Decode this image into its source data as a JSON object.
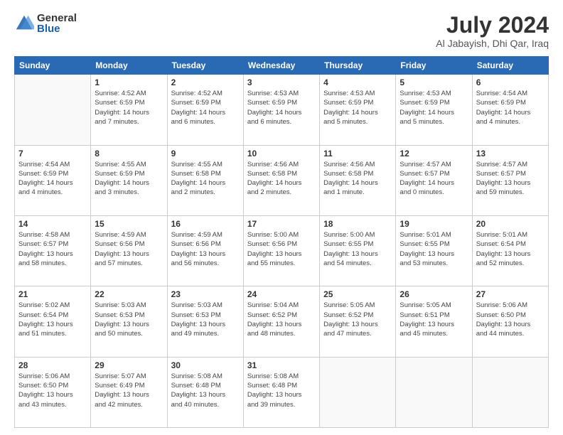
{
  "logo": {
    "general": "General",
    "blue": "Blue"
  },
  "title": "July 2024",
  "subtitle": "Al Jabayish, Dhi Qar, Iraq",
  "header_days": [
    "Sunday",
    "Monday",
    "Tuesday",
    "Wednesday",
    "Thursday",
    "Friday",
    "Saturday"
  ],
  "weeks": [
    [
      {
        "day": "",
        "info": ""
      },
      {
        "day": "1",
        "info": "Sunrise: 4:52 AM\nSunset: 6:59 PM\nDaylight: 14 hours\nand 7 minutes."
      },
      {
        "day": "2",
        "info": "Sunrise: 4:52 AM\nSunset: 6:59 PM\nDaylight: 14 hours\nand 6 minutes."
      },
      {
        "day": "3",
        "info": "Sunrise: 4:53 AM\nSunset: 6:59 PM\nDaylight: 14 hours\nand 6 minutes."
      },
      {
        "day": "4",
        "info": "Sunrise: 4:53 AM\nSunset: 6:59 PM\nDaylight: 14 hours\nand 5 minutes."
      },
      {
        "day": "5",
        "info": "Sunrise: 4:53 AM\nSunset: 6:59 PM\nDaylight: 14 hours\nand 5 minutes."
      },
      {
        "day": "6",
        "info": "Sunrise: 4:54 AM\nSunset: 6:59 PM\nDaylight: 14 hours\nand 4 minutes."
      }
    ],
    [
      {
        "day": "7",
        "info": "Sunrise: 4:54 AM\nSunset: 6:59 PM\nDaylight: 14 hours\nand 4 minutes."
      },
      {
        "day": "8",
        "info": "Sunrise: 4:55 AM\nSunset: 6:59 PM\nDaylight: 14 hours\nand 3 minutes."
      },
      {
        "day": "9",
        "info": "Sunrise: 4:55 AM\nSunset: 6:58 PM\nDaylight: 14 hours\nand 2 minutes."
      },
      {
        "day": "10",
        "info": "Sunrise: 4:56 AM\nSunset: 6:58 PM\nDaylight: 14 hours\nand 2 minutes."
      },
      {
        "day": "11",
        "info": "Sunrise: 4:56 AM\nSunset: 6:58 PM\nDaylight: 14 hours\nand 1 minute."
      },
      {
        "day": "12",
        "info": "Sunrise: 4:57 AM\nSunset: 6:57 PM\nDaylight: 14 hours\nand 0 minutes."
      },
      {
        "day": "13",
        "info": "Sunrise: 4:57 AM\nSunset: 6:57 PM\nDaylight: 13 hours\nand 59 minutes."
      }
    ],
    [
      {
        "day": "14",
        "info": "Sunrise: 4:58 AM\nSunset: 6:57 PM\nDaylight: 13 hours\nand 58 minutes."
      },
      {
        "day": "15",
        "info": "Sunrise: 4:59 AM\nSunset: 6:56 PM\nDaylight: 13 hours\nand 57 minutes."
      },
      {
        "day": "16",
        "info": "Sunrise: 4:59 AM\nSunset: 6:56 PM\nDaylight: 13 hours\nand 56 minutes."
      },
      {
        "day": "17",
        "info": "Sunrise: 5:00 AM\nSunset: 6:56 PM\nDaylight: 13 hours\nand 55 minutes."
      },
      {
        "day": "18",
        "info": "Sunrise: 5:00 AM\nSunset: 6:55 PM\nDaylight: 13 hours\nand 54 minutes."
      },
      {
        "day": "19",
        "info": "Sunrise: 5:01 AM\nSunset: 6:55 PM\nDaylight: 13 hours\nand 53 minutes."
      },
      {
        "day": "20",
        "info": "Sunrise: 5:01 AM\nSunset: 6:54 PM\nDaylight: 13 hours\nand 52 minutes."
      }
    ],
    [
      {
        "day": "21",
        "info": "Sunrise: 5:02 AM\nSunset: 6:54 PM\nDaylight: 13 hours\nand 51 minutes."
      },
      {
        "day": "22",
        "info": "Sunrise: 5:03 AM\nSunset: 6:53 PM\nDaylight: 13 hours\nand 50 minutes."
      },
      {
        "day": "23",
        "info": "Sunrise: 5:03 AM\nSunset: 6:53 PM\nDaylight: 13 hours\nand 49 minutes."
      },
      {
        "day": "24",
        "info": "Sunrise: 5:04 AM\nSunset: 6:52 PM\nDaylight: 13 hours\nand 48 minutes."
      },
      {
        "day": "25",
        "info": "Sunrise: 5:05 AM\nSunset: 6:52 PM\nDaylight: 13 hours\nand 47 minutes."
      },
      {
        "day": "26",
        "info": "Sunrise: 5:05 AM\nSunset: 6:51 PM\nDaylight: 13 hours\nand 45 minutes."
      },
      {
        "day": "27",
        "info": "Sunrise: 5:06 AM\nSunset: 6:50 PM\nDaylight: 13 hours\nand 44 minutes."
      }
    ],
    [
      {
        "day": "28",
        "info": "Sunrise: 5:06 AM\nSunset: 6:50 PM\nDaylight: 13 hours\nand 43 minutes."
      },
      {
        "day": "29",
        "info": "Sunrise: 5:07 AM\nSunset: 6:49 PM\nDaylight: 13 hours\nand 42 minutes."
      },
      {
        "day": "30",
        "info": "Sunrise: 5:08 AM\nSunset: 6:48 PM\nDaylight: 13 hours\nand 40 minutes."
      },
      {
        "day": "31",
        "info": "Sunrise: 5:08 AM\nSunset: 6:48 PM\nDaylight: 13 hours\nand 39 minutes."
      },
      {
        "day": "",
        "info": ""
      },
      {
        "day": "",
        "info": ""
      },
      {
        "day": "",
        "info": ""
      }
    ]
  ]
}
